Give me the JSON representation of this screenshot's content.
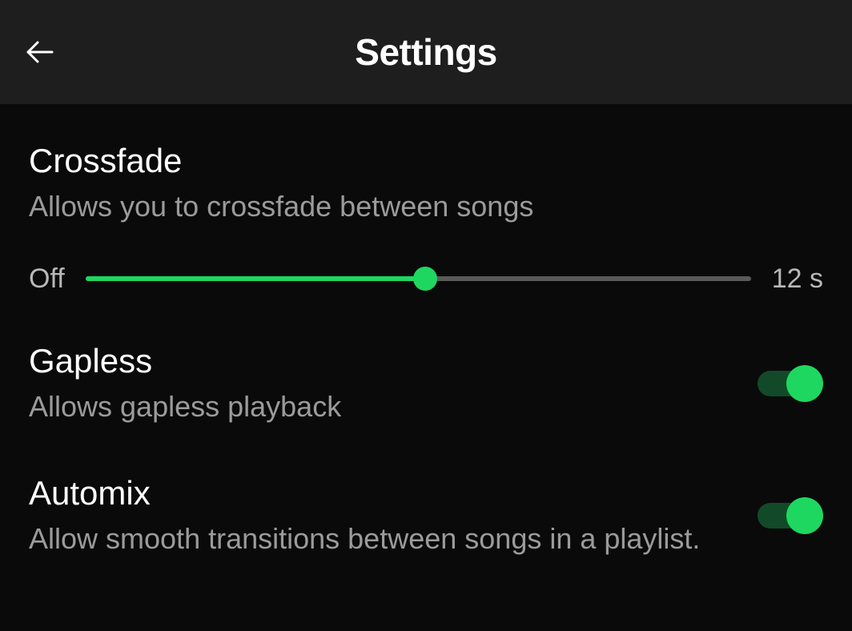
{
  "header": {
    "title": "Settings"
  },
  "crossfade": {
    "title": "Crossfade",
    "description": "Allows you to crossfade between songs",
    "slider": {
      "min_label": "Off",
      "max_label": "12 s",
      "percent": 51
    }
  },
  "gapless": {
    "title": "Gapless",
    "description": "Allows gapless playback",
    "enabled": true
  },
  "automix": {
    "title": "Automix",
    "description": "Allow smooth transitions between songs in a playlist.",
    "enabled": true
  },
  "colors": {
    "accent": "#1ed760",
    "header_bg": "#1e1e1e",
    "page_bg": "#0a0a0a",
    "text_secondary": "#9b9b9b"
  }
}
